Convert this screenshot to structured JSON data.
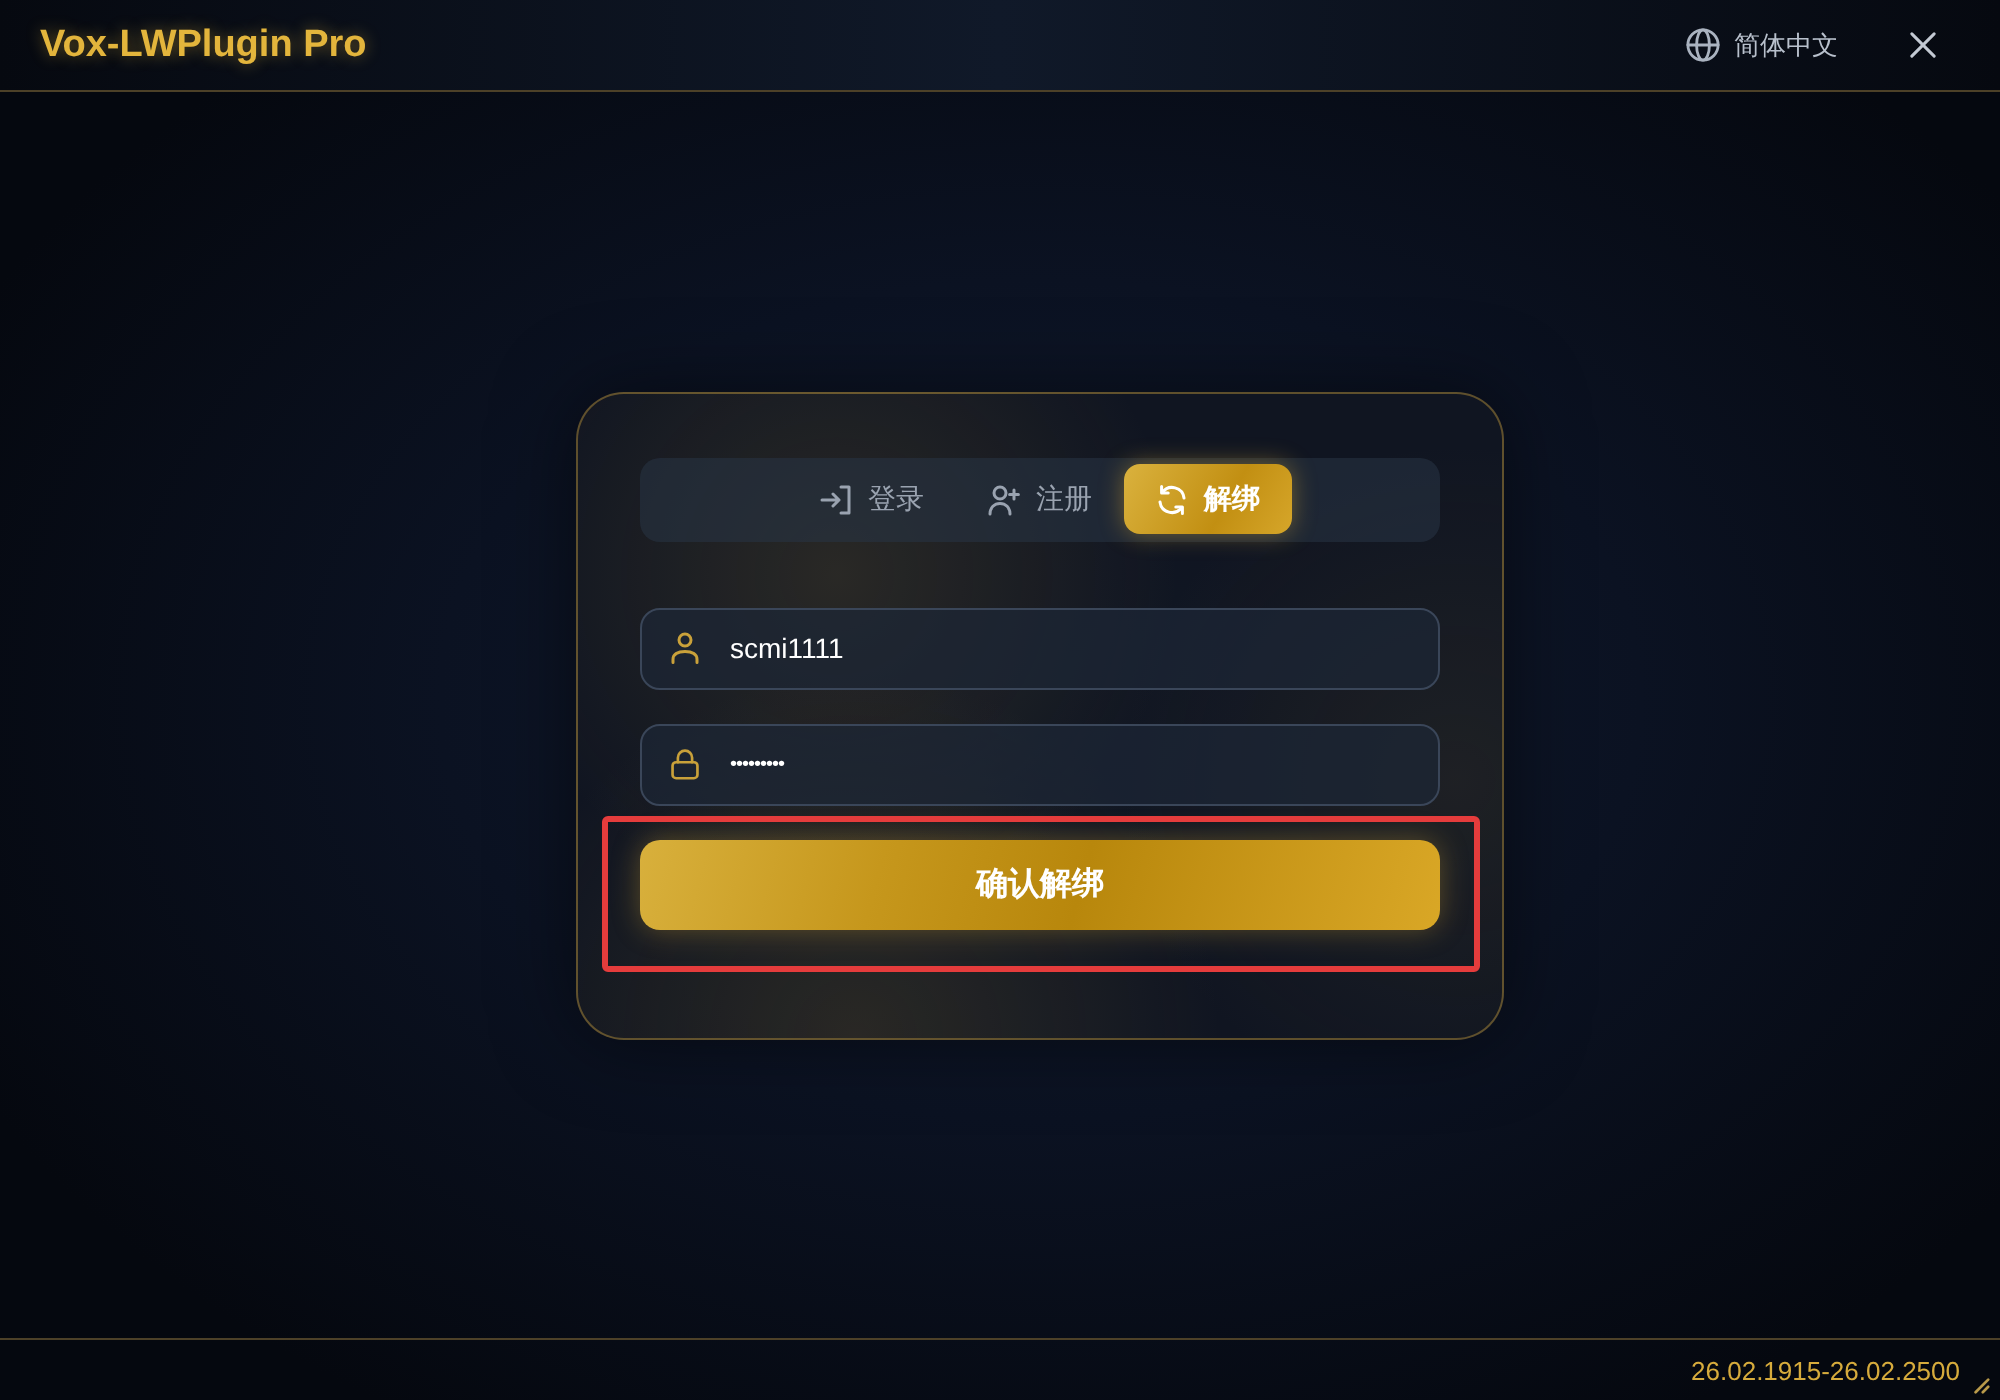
{
  "window": {
    "title": "Vox-LWPlugin Pro",
    "language_button": "简体中文"
  },
  "tabs": [
    {
      "kind": "login",
      "label": "登录",
      "selected": false
    },
    {
      "kind": "register",
      "label": "注册",
      "selected": false
    },
    {
      "kind": "unbind",
      "label": "解绑",
      "selected": true
    }
  ],
  "form": {
    "fields": [
      {
        "kind": "user",
        "value": "scmi1111"
      },
      {
        "kind": "password",
        "value": "•••••••••"
      }
    ],
    "submit": {
      "label": "确认解绑",
      "highlighted": true
    }
  },
  "status_bar": {
    "text": "26.02.1915-26.02.2500"
  }
}
